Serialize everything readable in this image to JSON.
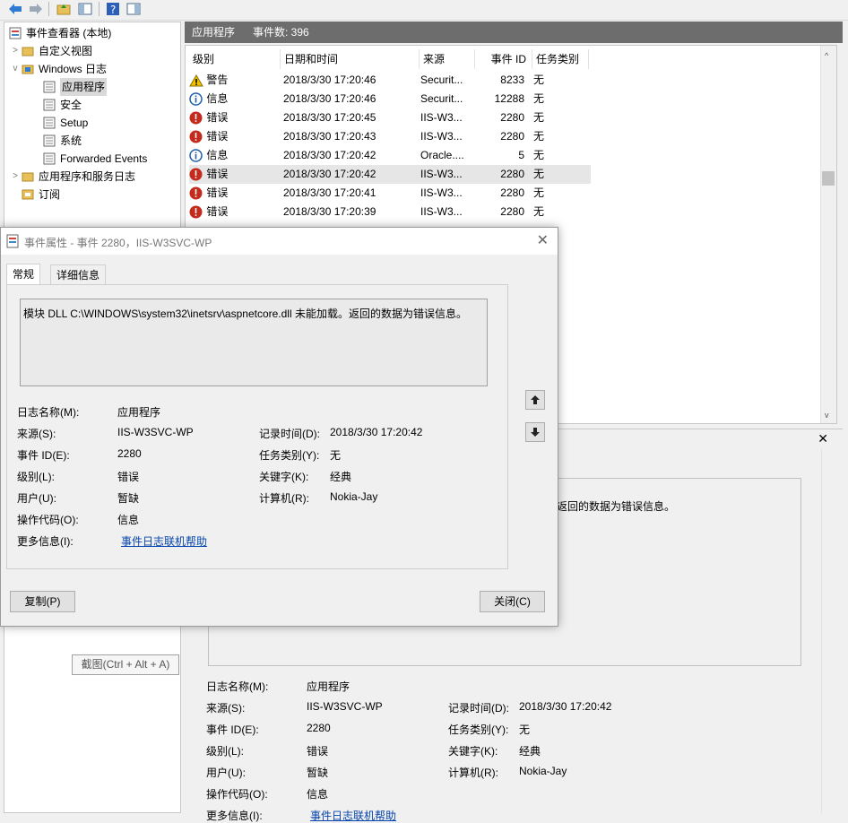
{
  "toolbar": {
    "icons": [
      "back-arrow-icon",
      "forward-arrow-icon",
      "folder-up-icon",
      "console-tree-icon",
      "help-icon",
      "action-pane-icon"
    ]
  },
  "tree": {
    "root": "事件查看器 (本地)",
    "custom_views": "自定义视图",
    "windows_logs": "Windows 日志",
    "application": "应用程序",
    "security": "安全",
    "setup": "Setup",
    "system": "系统",
    "forwarded": "Forwarded Events",
    "app_service_logs": "应用程序和服务日志",
    "subscriptions": "订阅"
  },
  "list": {
    "header_title": "应用程序",
    "header_count": "事件数: 396",
    "columns": [
      "级别",
      "日期和时间",
      "来源",
      "事件 ID",
      "任务类别"
    ],
    "rows": [
      {
        "level": "警告",
        "date": "2018/3/30 17:20:46",
        "source": "Securit...",
        "id": "8233",
        "category": "无",
        "icon": "warning"
      },
      {
        "level": "信息",
        "date": "2018/3/30 17:20:46",
        "source": "Securit...",
        "id": "12288",
        "category": "无",
        "icon": "info"
      },
      {
        "level": "错误",
        "date": "2018/3/30 17:20:45",
        "source": "IIS-W3...",
        "id": "2280",
        "category": "无",
        "icon": "error"
      },
      {
        "level": "错误",
        "date": "2018/3/30 17:20:43",
        "source": "IIS-W3...",
        "id": "2280",
        "category": "无",
        "icon": "error"
      },
      {
        "level": "信息",
        "date": "2018/3/30 17:20:42",
        "source": "Oracle....",
        "id": "5",
        "category": "无",
        "icon": "info"
      },
      {
        "level": "错误",
        "date": "2018/3/30 17:20:42",
        "source": "IIS-W3...",
        "id": "2280",
        "category": "无",
        "icon": "error"
      },
      {
        "level": "错误",
        "date": "2018/3/30 17:20:41",
        "source": "IIS-W3...",
        "id": "2280",
        "category": "无",
        "icon": "error"
      },
      {
        "level": "错误",
        "date": "2018/3/30 17:20:39",
        "source": "IIS-W3...",
        "id": "2280",
        "category": "无",
        "icon": "error"
      }
    ]
  },
  "preview": {
    "message_tail": "返回的数据为错误信息。",
    "log_name_label": "日志名称(M):",
    "log_name": "应用程序",
    "source_label": "来源(S):",
    "source": "IIS-W3SVC-WP",
    "logged_label": "记录时间(D):",
    "logged": "2018/3/30 17:20:42",
    "event_id_label": "事件 ID(E):",
    "event_id": "2280",
    "task_label": "任务类别(Y):",
    "task": "无",
    "level_label": "级别(L):",
    "level": "错误",
    "keywords_label": "关键字(K):",
    "keywords": "经典",
    "user_label": "用户(U):",
    "user": "暂缺",
    "computer_label": "计算机(R):",
    "computer": "Nokia-Jay",
    "opcode_label": "操作代码(O):",
    "opcode": "信息",
    "more_info_label": "更多信息(I):",
    "more_info": "事件日志联机帮助"
  },
  "dialog": {
    "title": "事件属性 - 事件 2280，IIS-W3SVC-WP",
    "tab_general": "常规",
    "tab_details": "详细信息",
    "message": "模块 DLL C:\\WINDOWS\\system32\\inetsrv\\aspnetcore.dll 未能加载。返回的数据为错误信息。",
    "log_name_label": "日志名称(M):",
    "log_name": "应用程序",
    "source_label": "来源(S):",
    "source": "IIS-W3SVC-WP",
    "logged_label": "记录时间(D):",
    "logged": "2018/3/30 17:20:42",
    "event_id_label": "事件 ID(E):",
    "event_id": "2280",
    "task_label": "任务类别(Y):",
    "task": "无",
    "level_label": "级别(L):",
    "level": "错误",
    "keywords_label": "关键字(K):",
    "keywords": "经典",
    "user_label": "用户(U):",
    "user": "暂缺",
    "computer_label": "计算机(R):",
    "computer": "Nokia-Jay",
    "opcode_label": "操作代码(O):",
    "opcode": "信息",
    "more_info_label": "更多信息(I):",
    "more_info": "事件日志联机帮助",
    "copy_button": "复制(P)",
    "close_button": "关闭(C)"
  },
  "tooltip": "截图(Ctrl + Alt + A)",
  "colors": {
    "header_bar": "#6d6d6d",
    "link": "#0645ad",
    "error": "#c42b1c",
    "info": "#1f5fa8",
    "warning": "#f2c200"
  }
}
